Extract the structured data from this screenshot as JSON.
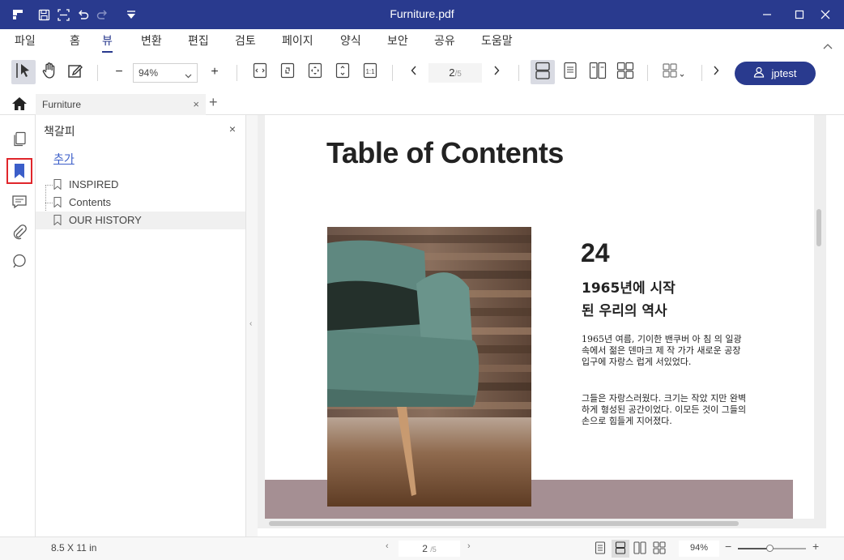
{
  "window": {
    "title": "Furniture.pdf",
    "accent_color": "#293a8e"
  },
  "menu": {
    "items": [
      {
        "label": "파일"
      },
      {
        "label": "홈"
      },
      {
        "label": "뷰"
      },
      {
        "label": "변환"
      },
      {
        "label": "편집"
      },
      {
        "label": "검토"
      },
      {
        "label": "페이지"
      },
      {
        "label": "양식"
      },
      {
        "label": "보안"
      },
      {
        "label": "공유"
      },
      {
        "label": "도움말"
      }
    ],
    "active": "뷰"
  },
  "toolbar": {
    "zoom_value": "94%",
    "zoom_out": "−",
    "zoom_in": "+",
    "page_current": "2",
    "page_total": "/5",
    "user_name": "jptest"
  },
  "tabs": {
    "document_tab": "Furniture",
    "close": "×",
    "new": "+"
  },
  "bookmark_panel": {
    "title": "책갈피",
    "close": "×",
    "add_label": "추가",
    "items": [
      {
        "label": "INSPIRED"
      },
      {
        "label": "Contents"
      },
      {
        "label": "OUR HISTORY"
      }
    ],
    "selected": "OUR HISTORY"
  },
  "document": {
    "heading": "Table of Contents",
    "number": "24",
    "subheading_line1": "1965년에 시작",
    "subheading_line2": "된 우리의 역사",
    "paragraph1": "1965년 여름, 기이한 밴쿠버 아 침 의 일광속에서 젊은 덴마크 제 작 가가 새로운 공장입구에 자랑스 럽게 서있었다.",
    "paragraph2": "그들은 자랑스러웠다. 크기는 작았 지만 완벽하게 형성된 공간이었다. 이모든 것이 그들의 손으로 힘들게 지어졌다."
  },
  "statusbar": {
    "page_size": "8.5 X 11 in",
    "page_current": "2",
    "page_total": "/5",
    "zoom": "94%",
    "zoom_level": 0.48
  }
}
